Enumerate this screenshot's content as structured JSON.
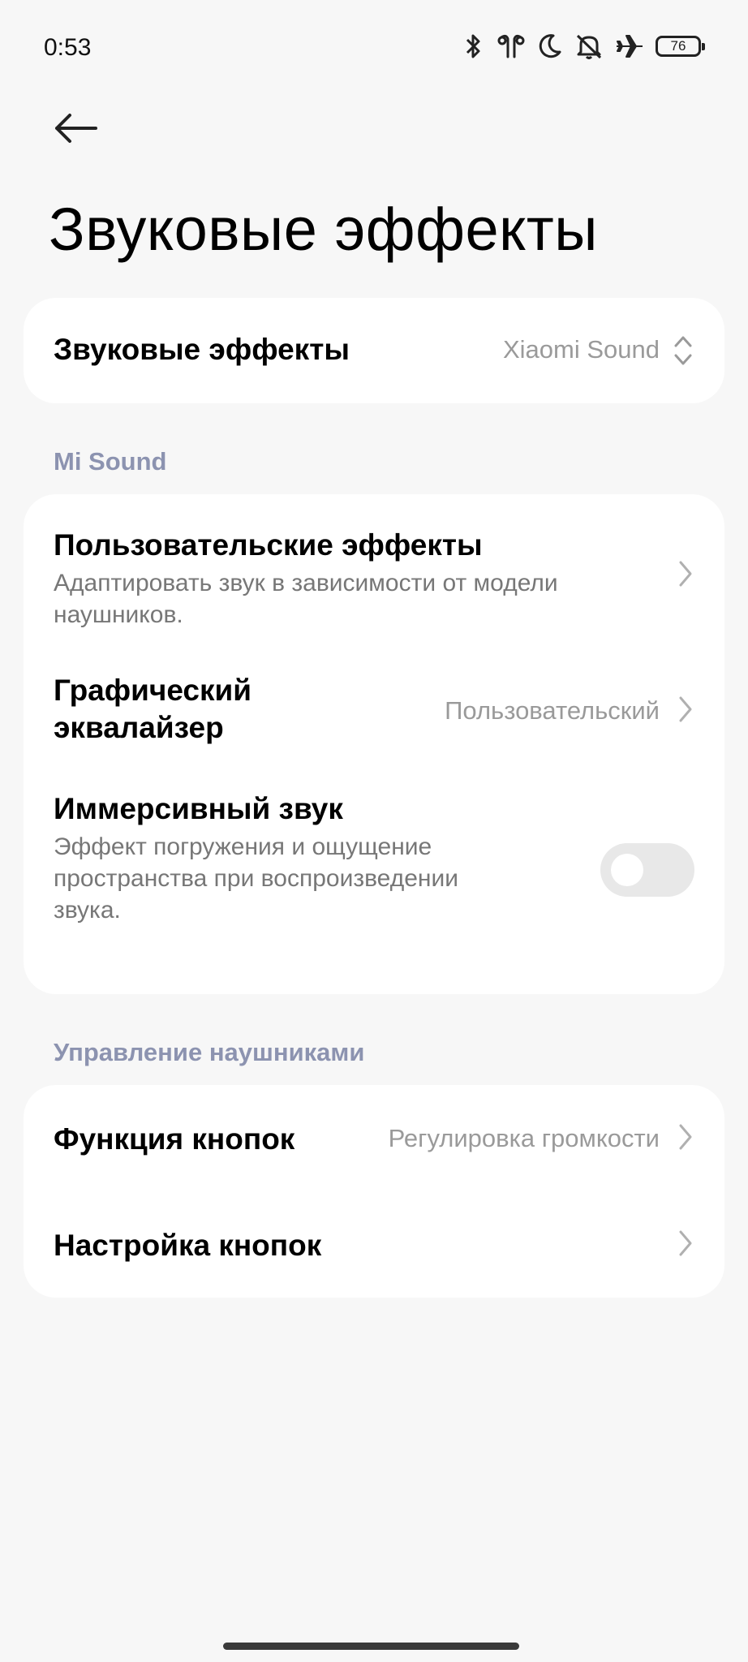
{
  "status_bar": {
    "time": "0:53",
    "battery": "76",
    "icons": [
      "bluetooth-icon",
      "earbuds-icon",
      "moon-icon",
      "bell-off-icon",
      "airplane-icon",
      "battery-icon"
    ]
  },
  "header": {
    "back_icon": "arrow-left-icon",
    "title": "Звуковые эффекты"
  },
  "sound_effects": {
    "label": "Звуковые эффекты",
    "value": "Xiaomi Sound"
  },
  "mi_sound": {
    "section_label": "Mi Sound",
    "items": [
      {
        "title": "Пользовательские эффекты",
        "subtitle_line1": "Адаптировать звук в зависимости от модели",
        "subtitle_line2": "наушников."
      },
      {
        "title_line1": "Графический",
        "title_line2": "эквалайзер",
        "value": "Пользовательский"
      },
      {
        "title": "Иммерсивный звук",
        "subtitle_line1": "Эффект погружения и ощущение",
        "subtitle_line2": "пространства при воспроизведении",
        "subtitle_line3": "звука.",
        "toggle_on": false
      }
    ]
  },
  "headphones": {
    "section_label": "Управление наушниками",
    "items": [
      {
        "title": "Функция кнопок",
        "value": "Регулировка громкости"
      },
      {
        "title": "Настройка кнопок"
      }
    ]
  },
  "colors": {
    "background": "#f7f7f7",
    "card": "#ffffff",
    "section_label": "#8c93b0",
    "secondary_text": "#9a9a9a"
  }
}
